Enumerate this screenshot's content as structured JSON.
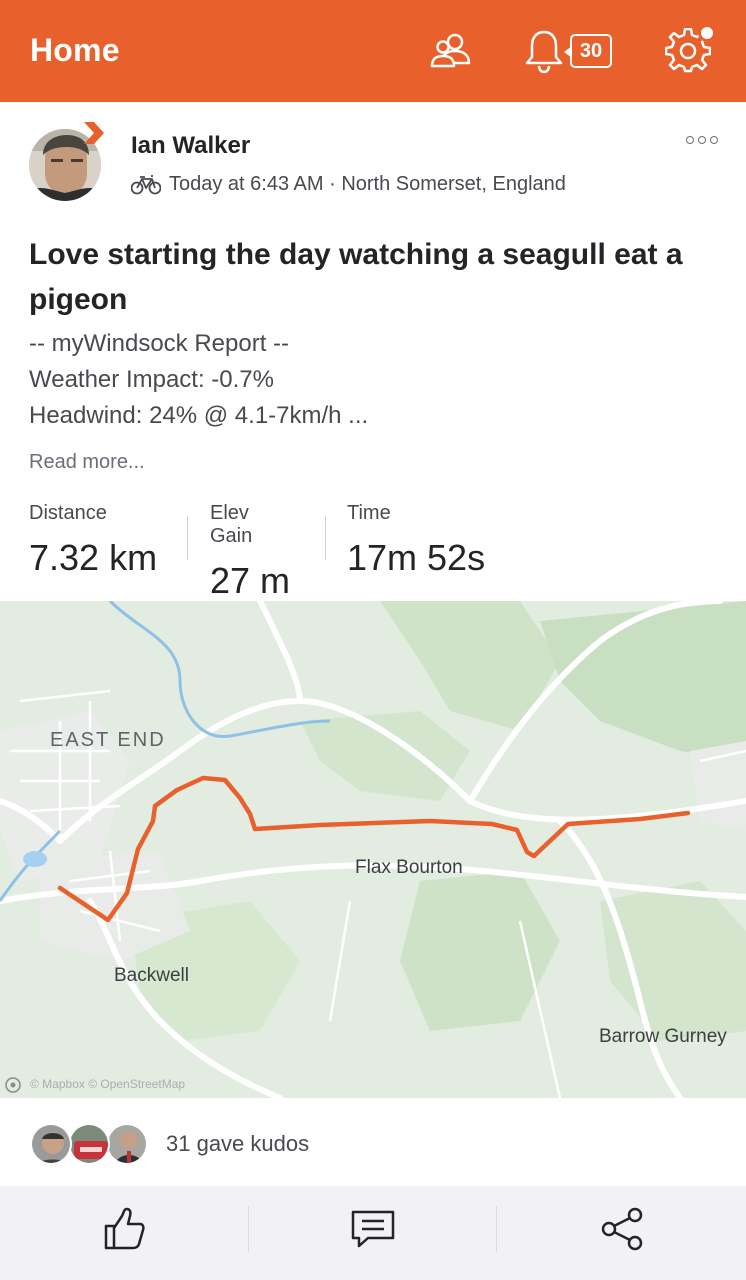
{
  "header": {
    "title": "Home",
    "notification_count": "30",
    "icons": [
      "friends-icon",
      "bell-icon",
      "gear-icon"
    ],
    "accent_color": "#e8612c"
  },
  "post": {
    "athlete_name": "Ian Walker",
    "activity_icon": "bike-icon",
    "meta": "Today at 6:43 AM · North Somerset, England",
    "title": "Love starting the day watching a seagull eat a pigeon",
    "description_lines": [
      "-- myWindsock Report --",
      "Weather Impact: -0.7%",
      "Headwind: 24% @ 4.1-7km/h ..."
    ],
    "read_more": "Read more..."
  },
  "stats": [
    {
      "label": "Distance",
      "value": "7.32 km"
    },
    {
      "label": "Elev Gain",
      "value": "27 m"
    },
    {
      "label": "Time",
      "value": "17m 52s"
    }
  ],
  "map": {
    "labels": {
      "east_end": "EAST END",
      "flax_bourton": "Flax Bourton",
      "backwell": "Backwell",
      "barrow_gurney": "Barrow Gurney"
    },
    "attribution": "© Mapbox © OpenStreetMap",
    "route_color": "#e8612c"
  },
  "kudos": {
    "text": "31 gave kudos"
  },
  "actions": [
    "kudos-thumb-icon",
    "comment-icon",
    "share-icon"
  ]
}
